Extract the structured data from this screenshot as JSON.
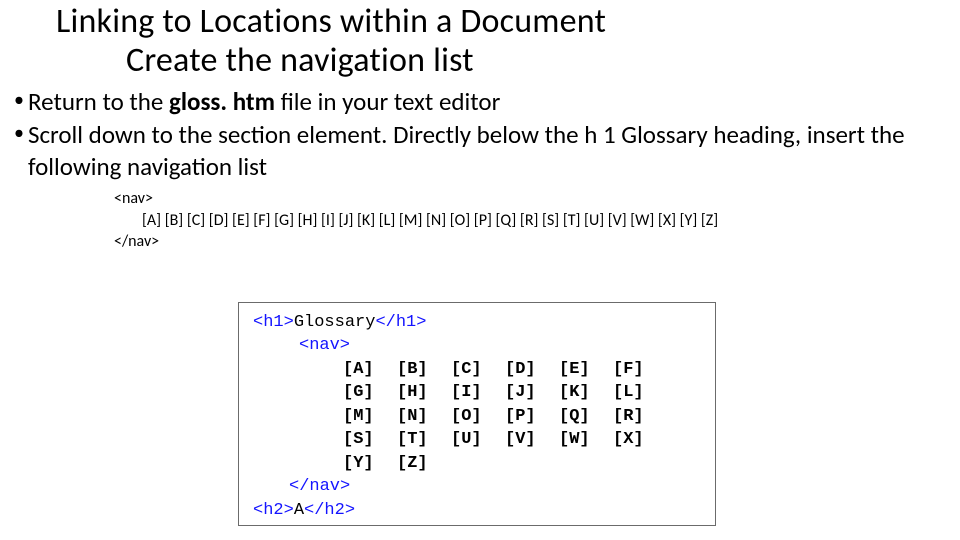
{
  "title": "Linking to Locations within a Document",
  "subtitle": "Create the navigation list",
  "bullets": {
    "b1_pre": "Return to the ",
    "b1_bold": "gloss. htm",
    "b1_post": " file in your text editor",
    "b2": "Scroll down to the section element. Directly below the h 1 Glossary heading, insert the following navigation list"
  },
  "code": {
    "open": "<nav>",
    "letters_line": "[A] [B] [C] [D] [E] [F] [G] [H] [I] [J] [K] [L] [M] [N] [O] [P] [Q] [R] [S] [T] [U] [V] [W] [X] [Y] [Z]",
    "close": "</nav>"
  },
  "figure": {
    "h1_open": "<h1>",
    "h1_text": "Glossary",
    "h1_close": "</h1>",
    "nav_open": "<nav>",
    "letters": [
      "[A]",
      "[B]",
      "[C]",
      "[D]",
      "[E]",
      "[F]",
      "[G]",
      "[H]",
      "[I]",
      "[J]",
      "[K]",
      "[L]",
      "[M]",
      "[N]",
      "[O]",
      "[P]",
      "[Q]",
      "[R]",
      "[S]",
      "[T]",
      "[U]",
      "[V]",
      "[W]",
      "[X]",
      "[Y]",
      "[Z]"
    ],
    "nav_close": "</nav>",
    "h2_open": "<h2>",
    "h2_text": "A",
    "h2_close": "</h2>"
  }
}
